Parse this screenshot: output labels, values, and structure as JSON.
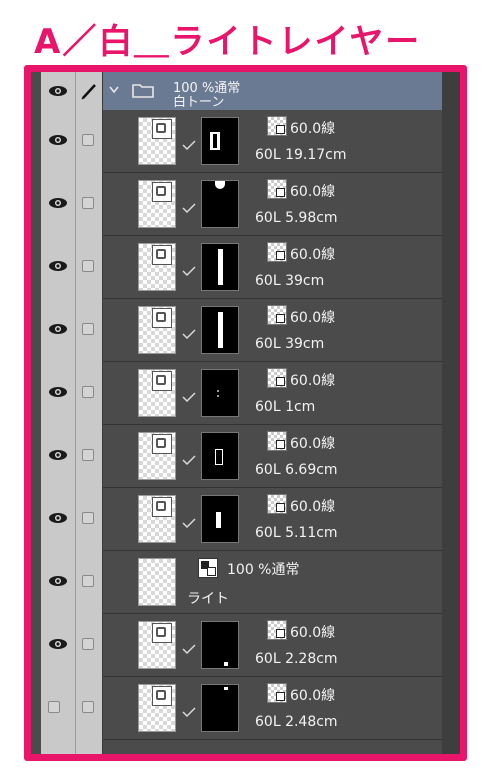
{
  "heading": "A／白＿ライトレイヤー",
  "folder": {
    "mode": "100 %通常",
    "name": "白トーン"
  },
  "layers": [
    {
      "tone": "60.0線",
      "info": "60L 19.17cm",
      "visible": true
    },
    {
      "tone": "60.0線",
      "info": "60L 5.98cm",
      "visible": true
    },
    {
      "tone": "60.0線",
      "info": "60L 39cm",
      "visible": true
    },
    {
      "tone": "60.0線",
      "info": "60L 39cm",
      "visible": true
    },
    {
      "tone": "60.0線",
      "info": "60L 1cm",
      "visible": true
    },
    {
      "tone": "60.0線",
      "info": "60L 6.69cm",
      "visible": true
    },
    {
      "tone": "60.0線",
      "info": "60L 5.11cm",
      "visible": true
    }
  ],
  "light_layer": {
    "mode": "100 %通常",
    "name": "ライト",
    "visible": true
  },
  "bottom_layers": [
    {
      "tone": "60.0線",
      "info": "60L 2.28cm",
      "visible": true
    },
    {
      "tone": "60.0線",
      "info": "60L 2.48cm",
      "visible": false
    }
  ],
  "colors": {
    "accent": "#e8156b",
    "folder_bg": "#6b7a93",
    "panel_bg": "#4b4b4b"
  }
}
